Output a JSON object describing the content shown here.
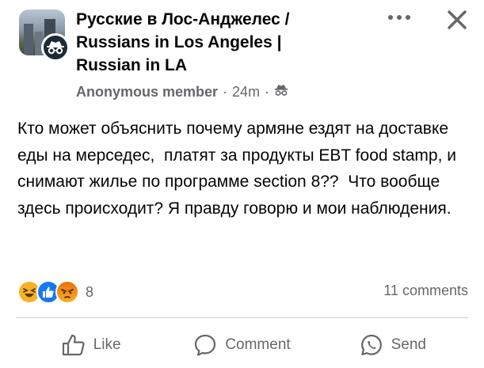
{
  "header": {
    "group_name": "Русские в Лос-Анджелес / Russians in Los Angeles | Russian in LA",
    "author": "Anonymous member",
    "separator": "·",
    "time": "24m",
    "privacy_icon": "anonymous-icon",
    "more_icon": "more-dots-icon",
    "close_icon": "close-icon"
  },
  "post": {
    "text": "Кто может объяснить почему армяне ездят на доставке еды на мерседес,  платят за продукты EBT food stamp, и снимают жилье по программе section 8??  Что вообще здесь происходит? Я правду говорю и мои наблюдения."
  },
  "reactions": {
    "icons": [
      "haha-reaction-icon",
      "like-reaction-icon",
      "angry-reaction-icon"
    ],
    "count": "8",
    "comments": "11 comments"
  },
  "actions": {
    "like": "Like",
    "comment": "Comment",
    "send": "Send"
  },
  "colors": {
    "text": "#050505",
    "secondary": "#65676b",
    "like_blue": "#1877f2",
    "haha_yellow": "#f7b125",
    "angry_orange": "#e9710f",
    "divider": "#ced0d4"
  }
}
